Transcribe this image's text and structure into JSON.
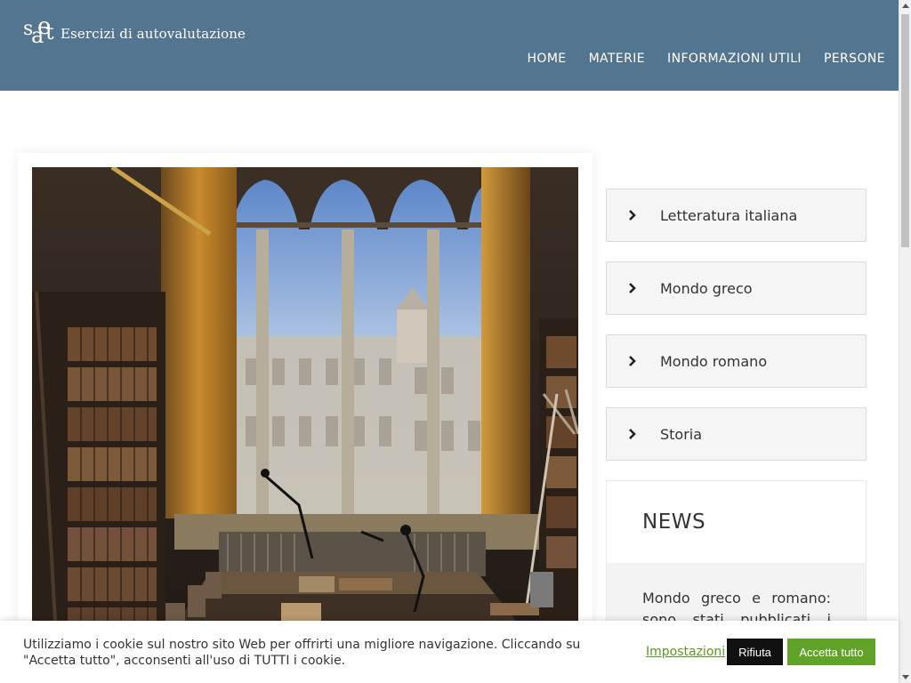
{
  "header": {
    "logo_text": "Esercizi di autovalutazione",
    "nav": [
      "HOME",
      "MATERIE",
      "INFORMAZIONI UTILI",
      "PERSONE"
    ]
  },
  "sidebar": {
    "items": [
      {
        "label": "Letteratura italiana",
        "icon": "chevron-right-icon"
      },
      {
        "label": "Mondo greco",
        "icon": "chevron-right-icon"
      },
      {
        "label": "Mondo romano",
        "icon": "chevron-right-icon"
      },
      {
        "label": "Storia",
        "icon": "chevron-right-icon"
      }
    ]
  },
  "news": {
    "title": "NEWS",
    "text": "Mondo greco e romano: sono stati pubblicati i"
  },
  "cookie": {
    "message": "Utilizziamo i cookie sul nostro sito Web per offrirti una migliore navigazione. Cliccando su \"Accetta tutto\", acconsenti all'uso di TUTTI i cookie.",
    "settings_label": "Impostazioni",
    "reject_label": "Rifiuta",
    "accept_label": "Accetta tutto"
  },
  "colors": {
    "header_bg": "#54758f",
    "accept_bg": "#61a229",
    "reject_bg": "#111111"
  }
}
